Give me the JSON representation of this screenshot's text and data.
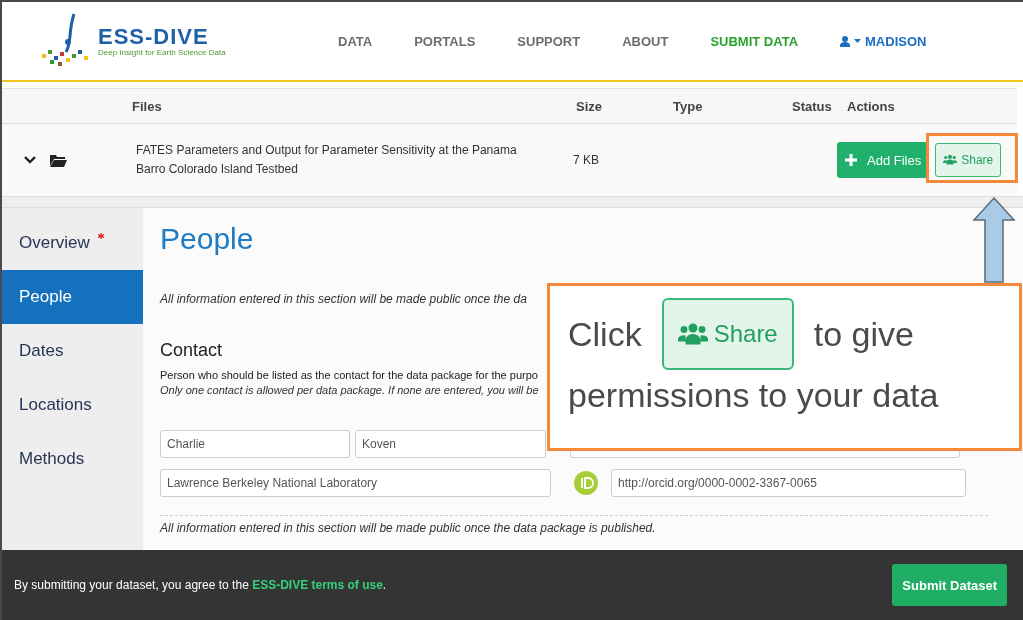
{
  "header": {
    "logo": {
      "title": "ESS-DIVE",
      "tagline": "Deep Insight for Earth Science Data"
    },
    "nav": [
      {
        "label": "DATA",
        "selected": false
      },
      {
        "label": "PORTALS",
        "selected": false
      },
      {
        "label": "SUPPORT",
        "selected": false
      },
      {
        "label": "ABOUT",
        "selected": false
      },
      {
        "label": "SUBMIT DATA",
        "selected": true
      }
    ],
    "user": {
      "name": "MADISON"
    }
  },
  "files_table": {
    "columns": [
      "Files",
      "Size",
      "Type",
      "Status",
      "Actions"
    ],
    "rows": [
      {
        "name": "FATES Parameters and Output for Parameter Sensitivity at the Panama Barro Colorado Island Testbed",
        "size": "7 KB",
        "expanded": true,
        "actions": [
          "Add Files",
          "Share"
        ]
      }
    ]
  },
  "sidebar": {
    "items": [
      {
        "label": "Overview",
        "required": true,
        "selected": false
      },
      {
        "label": "People",
        "required": false,
        "selected": true
      },
      {
        "label": "Dates",
        "required": false,
        "selected": false
      },
      {
        "label": "Locations",
        "required": false,
        "selected": false
      },
      {
        "label": "Methods",
        "required": false,
        "selected": false
      }
    ]
  },
  "section": {
    "title": "People",
    "notice": "All information entered in this section will be made public once the da",
    "contact": {
      "heading": "Contact",
      "description": "Person who should be listed as the contact for the data package for the purpo",
      "note": "Only one contact is allowed per data package. If none are entered, you will be",
      "first_name": "Charlie",
      "last_name": "Koven",
      "organization": "Lawrence Berkeley National Laboratory",
      "orcid": "http://orcid.org/0000-0002-3367-0065"
    },
    "footer_notice": "All information entered in this section will be made public once the data package is published."
  },
  "callout": {
    "before": "Click",
    "button": "Share",
    "after": "to give",
    "line2": "permissions to your data"
  },
  "footer": {
    "text_before": "By submitting your dataset, you agree to the ",
    "link": "ESS-DIVE terms of use",
    "text_after": ".",
    "button": "Submit Dataset"
  }
}
